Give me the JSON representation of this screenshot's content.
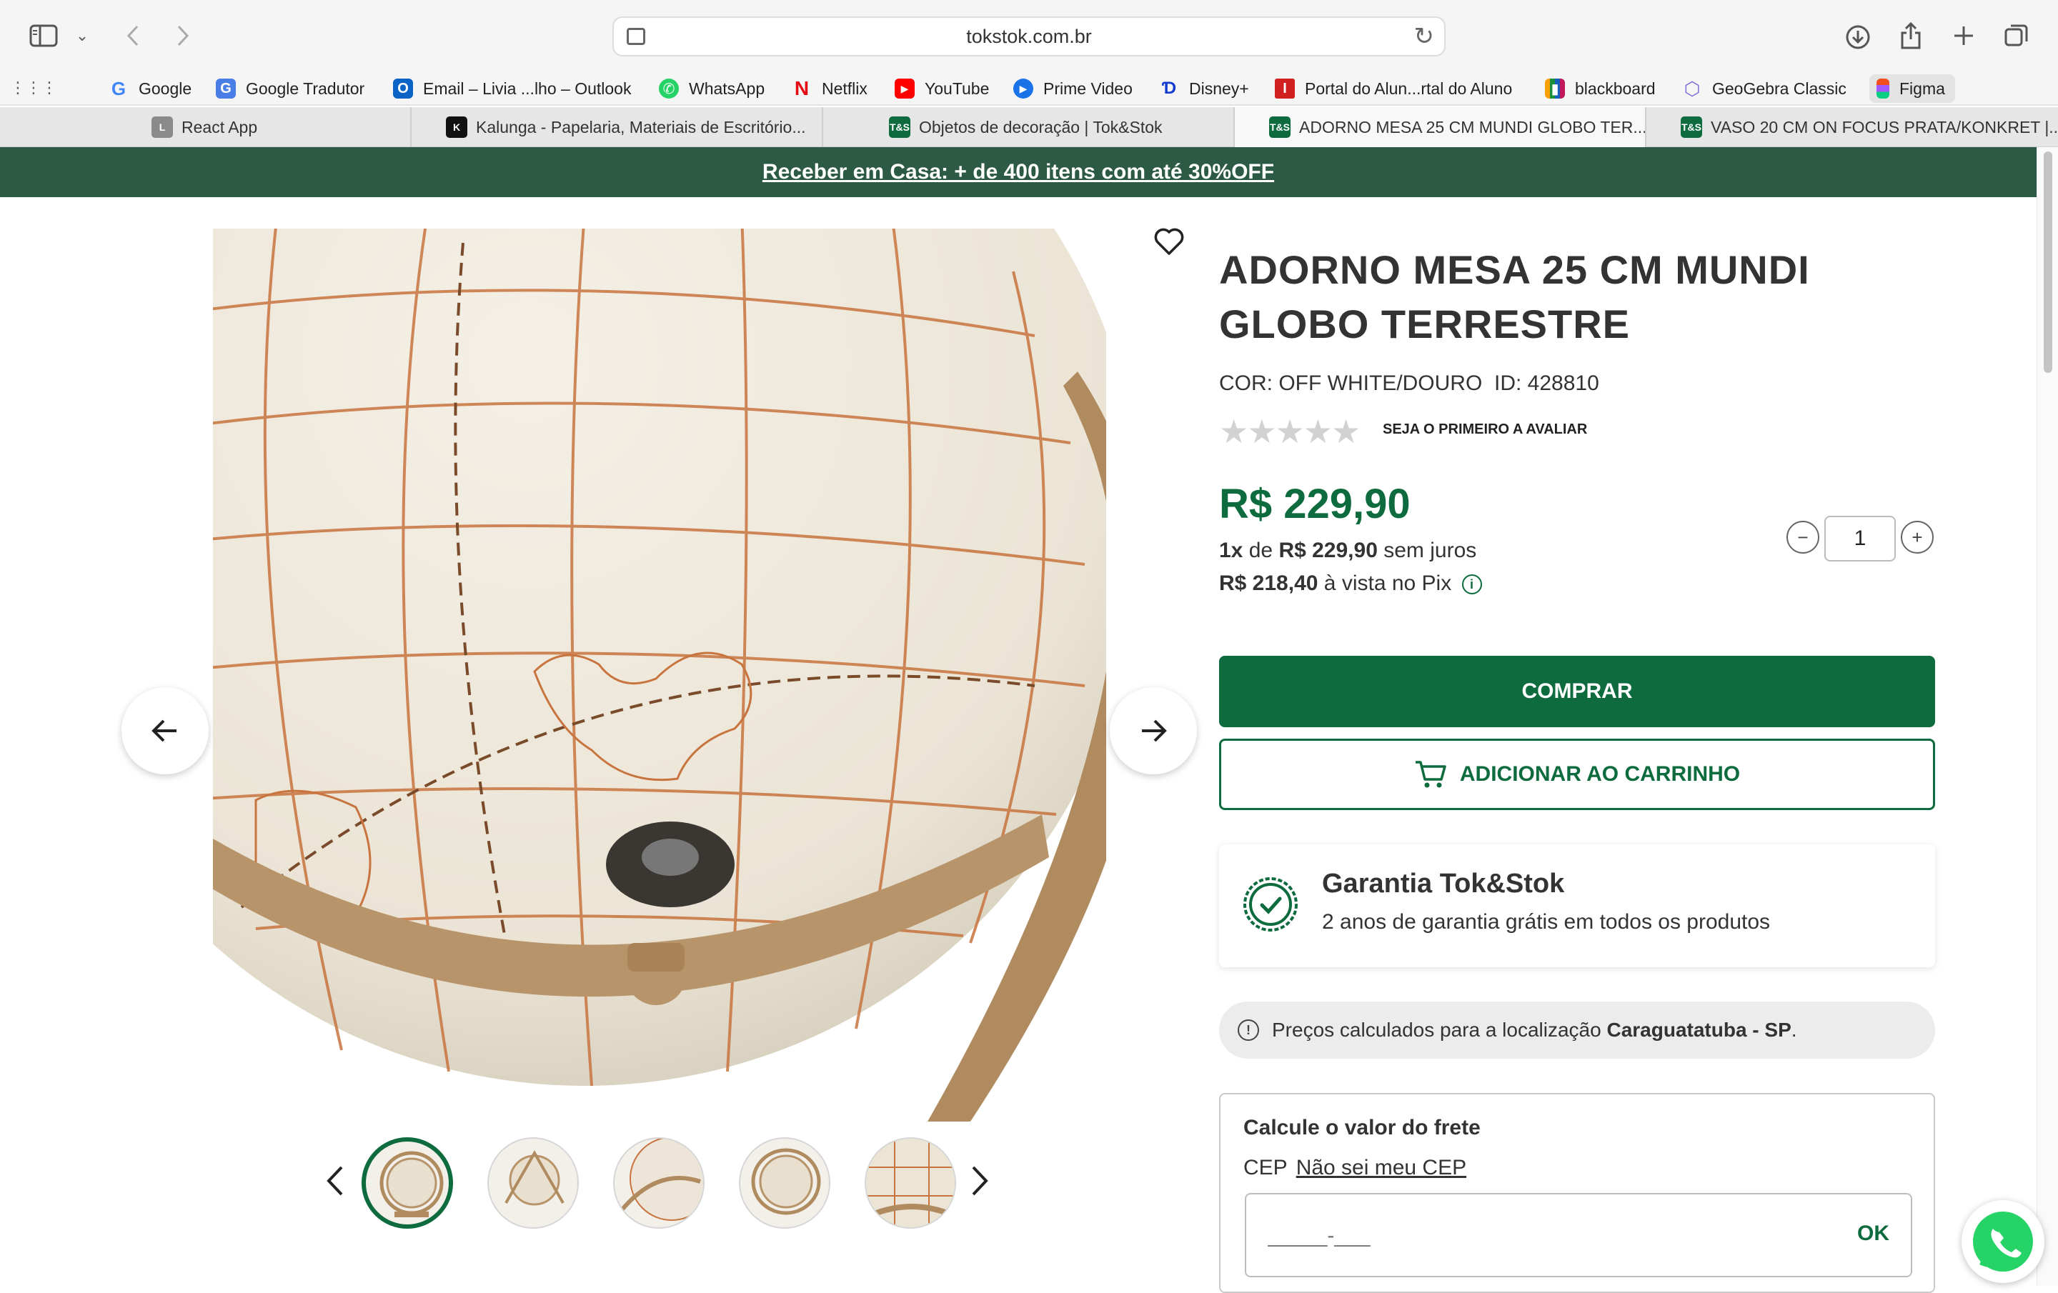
{
  "browser": {
    "url": "tokstok.com.br",
    "bookmarks": [
      {
        "label": "Google",
        "icon": "google-icon",
        "color": "#4285f4"
      },
      {
        "label": "Google Tradutor",
        "icon": "translate-icon",
        "color": "#4a7ee6"
      },
      {
        "label": "Email – Livia ...lho – Outlook",
        "icon": "outlook-icon",
        "color": "#0a64c8"
      },
      {
        "label": "WhatsApp",
        "icon": "whatsapp-icon",
        "color": "#25d366"
      },
      {
        "label": "Netflix",
        "icon": "netflix-icon",
        "color": "#e50914"
      },
      {
        "label": "YouTube",
        "icon": "youtube-icon",
        "color": "#ff0000"
      },
      {
        "label": "Prime Video",
        "icon": "prime-video-icon",
        "color": "#1a73e8"
      },
      {
        "label": "Disney+",
        "icon": "disney-icon",
        "color": "#113ccf"
      },
      {
        "label": "Portal do Alun...rtal do Aluno",
        "icon": "portal-icon",
        "color": "#d21f1f"
      },
      {
        "label": "blackboard",
        "icon": "blackboard-icon",
        "color": "#222222"
      },
      {
        "label": "GeoGebra Classic",
        "icon": "geogebra-icon",
        "color": "#7f6ad4"
      },
      {
        "label": "Figma",
        "icon": "figma-icon",
        "color": "#f24e1e"
      }
    ],
    "tabs": [
      {
        "label": "React App",
        "icon": "react-app-icon",
        "active": false
      },
      {
        "label": "Kalunga - Papelaria, Materiais de Escritório...",
        "icon": "kalunga-icon",
        "active": false
      },
      {
        "label": "Objetos de decoração | Tok&Stok",
        "icon": "tokstok-icon",
        "active": false
      },
      {
        "label": "ADORNO MESA 25 CM MUNDI GLOBO TER...",
        "icon": "tokstok-icon",
        "active": true
      },
      {
        "label": "VASO 20 CM ON FOCUS PRATA/KONKRET |...",
        "icon": "tokstok-icon",
        "active": false
      }
    ]
  },
  "promo": {
    "text": "Receber em Casa: + de 400 itens com até 30%OFF",
    "color": "#2c5a44"
  },
  "product": {
    "title": "ADORNO MESA 25 CM MUNDI GLOBO TERRESTRE",
    "color_label": "COR: OFF WHITE/DOURO",
    "id_label": "ID: 428810",
    "rating_stars": 0,
    "rating_cta": "SEJA O PRIMEIRO A AVALIAR",
    "price": "R$ 229,90",
    "installments": {
      "count": "1x",
      "of": "de",
      "amount": "R$ 229,90",
      "suffix": "sem juros"
    },
    "pix": {
      "amount": "R$ 218,40",
      "suffix": "à vista no Pix"
    },
    "quantity": "1",
    "buy_label": "COMPRAR",
    "cart_label": "ADICIONAR AO CARRINHO",
    "accent": "#0d6b3e"
  },
  "warranty": {
    "title": "Garantia Tok&Stok",
    "subtitle": "2 anos de garantia grátis em todos os produtos"
  },
  "location": {
    "prefix": "Preços calculados para a localização",
    "city": "Caraguatatuba - SP",
    "suffix": "."
  },
  "shipping": {
    "title": "Calcule o valor do frete",
    "cep_label": "CEP",
    "cep_link": "Não sei meu CEP",
    "placeholder": "_____-___",
    "ok_label": "OK"
  },
  "gallery": {
    "thumbnail_count": 5,
    "active_thumbnail": 1
  }
}
